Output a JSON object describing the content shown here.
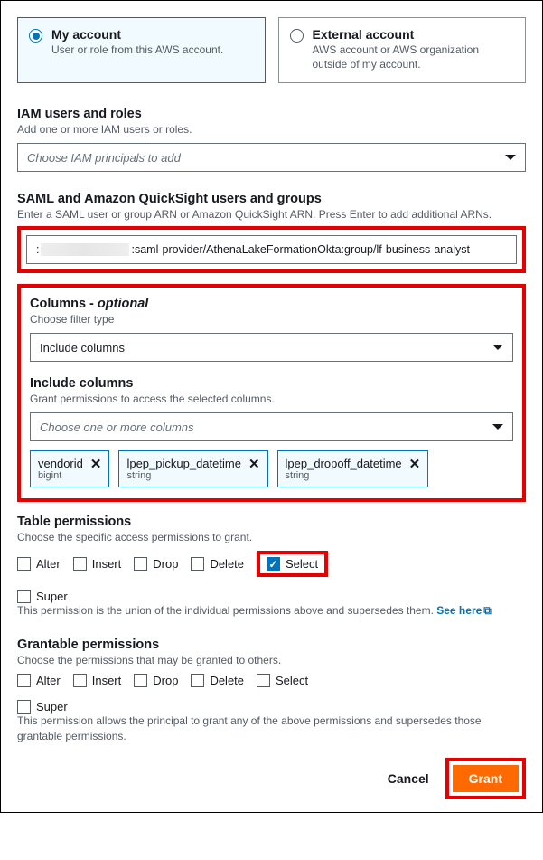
{
  "account": {
    "my": {
      "title": "My account",
      "sub": "User or role from this AWS account."
    },
    "external": {
      "title": "External account",
      "sub": "AWS account or AWS organization outside of my account."
    }
  },
  "iam": {
    "title": "IAM users and roles",
    "sub": "Add one or more IAM users or roles.",
    "placeholder": "Choose IAM principals to add"
  },
  "saml": {
    "title": "SAML and Amazon QuickSight users and groups",
    "sub": "Enter a SAML user or group ARN or Amazon QuickSight ARN. Press Enter to add additional ARNs.",
    "arn_prefix": ":",
    "arn_suffix": ":saml-provider/AthenaLakeFormationOkta:group/lf-business-analyst"
  },
  "columns": {
    "title_a": "Columns - ",
    "title_b": "optional",
    "sub": "Choose filter type",
    "filter_value": "Include columns",
    "inc_title": "Include columns",
    "inc_sub": "Grant permissions to access the selected columns.",
    "inc_placeholder": "Choose one or more columns",
    "chips": [
      {
        "name": "vendorid",
        "type": "bigint"
      },
      {
        "name": "lpep_pickup_datetime",
        "type": "string"
      },
      {
        "name": "lpep_dropoff_datetime",
        "type": "string"
      }
    ]
  },
  "tperm": {
    "title": "Table permissions",
    "sub": "Choose the specific access permissions to grant.",
    "opts": {
      "alter": "Alter",
      "insert": "Insert",
      "drop": "Drop",
      "delete": "Delete",
      "select": "Select"
    },
    "super": "Super",
    "super_note": "This permission is the union of the individual permissions above and supersedes them. ",
    "see_here": "See here"
  },
  "gperm": {
    "title": "Grantable permissions",
    "sub": "Choose the permissions that may be granted to others.",
    "super_note": "This permission allows the principal to grant any of the above permissions and supersedes those grantable permissions."
  },
  "footer": {
    "cancel": "Cancel",
    "grant": "Grant"
  }
}
